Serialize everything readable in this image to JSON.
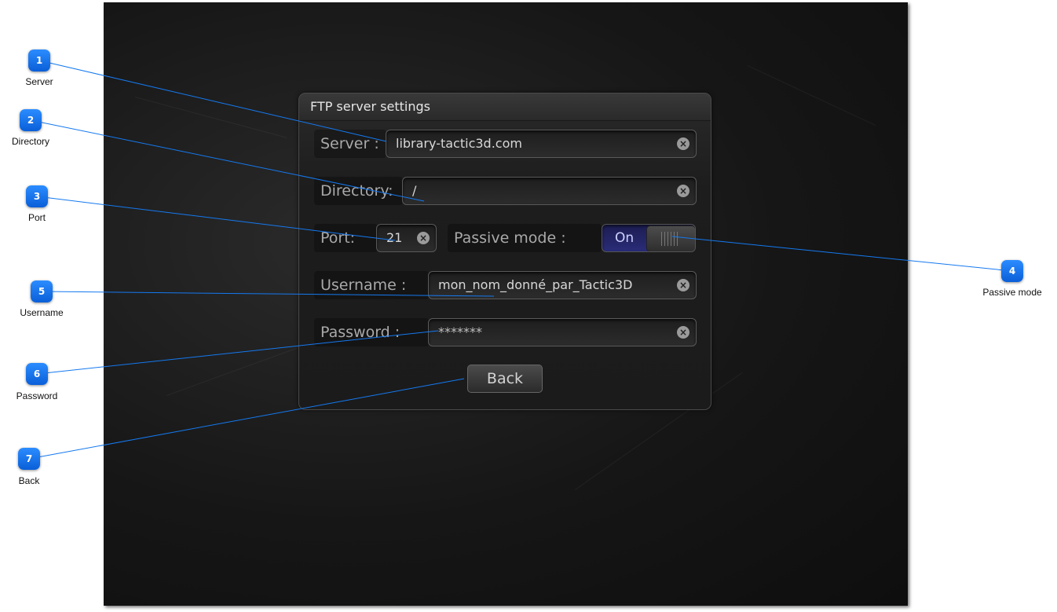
{
  "dialog": {
    "title": "FTP server settings",
    "server": {
      "label": "Server :",
      "value": "library-tactic3d.com"
    },
    "directory": {
      "label": "Directory:",
      "value": "/"
    },
    "port": {
      "label": "Port:",
      "value": "21"
    },
    "passive_mode": {
      "label": "Passive mode :",
      "state": "On"
    },
    "username": {
      "label": "Username :",
      "value": "mon_nom_donné_par_Tactic3D"
    },
    "password": {
      "label": "Password :",
      "value": "*******"
    },
    "back_label": "Back",
    "clear_icon": "clear-icon"
  },
  "callouts": [
    {
      "number": "1",
      "label": "Server"
    },
    {
      "number": "2",
      "label": "Directory"
    },
    {
      "number": "3",
      "label": "Port"
    },
    {
      "number": "4",
      "label": "Passive mode"
    },
    {
      "number": "5",
      "label": "Username"
    },
    {
      "number": "6",
      "label": "Password"
    },
    {
      "number": "7",
      "label": "Back"
    }
  ],
  "colors": {
    "callout_blue": "#1479f0",
    "toggle_on": "#22246a"
  }
}
